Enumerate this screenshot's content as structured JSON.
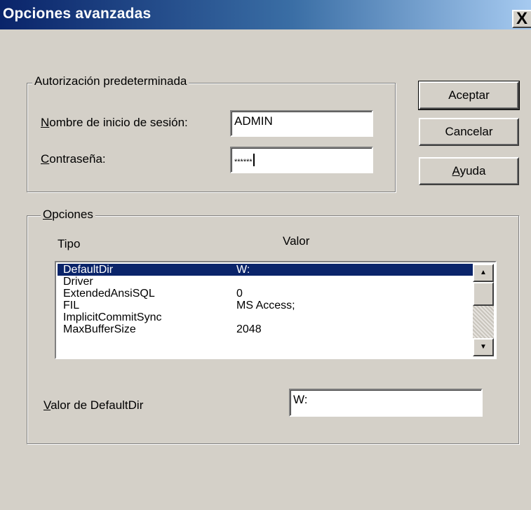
{
  "window": {
    "title": "Opciones avanzadas",
    "close_glyph": "X"
  },
  "auth_group": {
    "legend": "Autorización predeterminada",
    "login_label_accel": "N",
    "login_label_rest": "ombre de inicio de sesión:",
    "login_value": "ADMIN",
    "password_label_accel": "C",
    "password_label_rest": "ontraseña:",
    "password_value": "******"
  },
  "buttons": {
    "accept": "Aceptar",
    "cancel": "Cancelar",
    "help_accel": "A",
    "help_rest": "yuda"
  },
  "options_group": {
    "legend_accel": "O",
    "legend_rest": "pciones",
    "col_type": "Tipo",
    "col_value": "Valor",
    "rows": [
      {
        "name": "DefaultDir",
        "value": "W:"
      },
      {
        "name": "Driver",
        "value": ""
      },
      {
        "name": "ExtendedAnsiSQL",
        "value": "0"
      },
      {
        "name": "FIL",
        "value": "MS Access;"
      },
      {
        "name": "ImplicitCommitSync",
        "value": ""
      },
      {
        "name": "MaxBufferSize",
        "value": "2048"
      }
    ],
    "selected_index": 0,
    "value_label_accel": "V",
    "value_label_rest": "alor de  DefaultDir",
    "value_field": "W:",
    "scroll_up_glyph": "▲",
    "scroll_down_glyph": "▼"
  },
  "colors": {
    "title_gradient_start": "#0a246a",
    "title_gradient_end": "#a6caf0",
    "dialog_face": "#d4d0c8",
    "selection": "#0a246a"
  }
}
